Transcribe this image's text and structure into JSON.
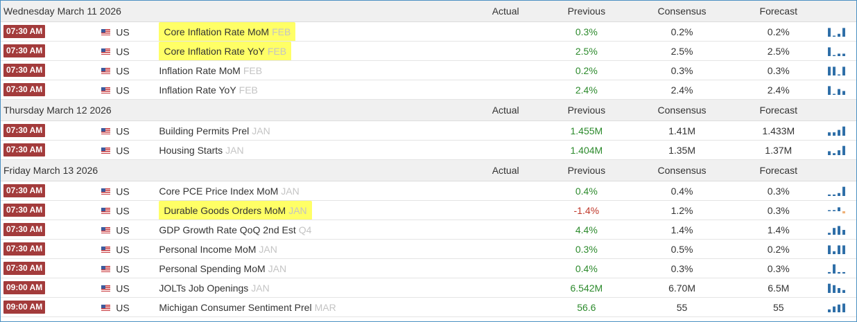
{
  "columns": {
    "actual": "Actual",
    "previous": "Previous",
    "consensus": "Consensus",
    "forecast": "Forecast"
  },
  "colors": {
    "time_badge": "#a33b3b",
    "positive": "#2c8a2c",
    "negative": "#c0392b",
    "highlight": "#ffff66",
    "spark_bar": "#2f6fa8",
    "spark_neg": "#f0b27a"
  },
  "days": [
    {
      "label": "Wednesday March 11 2026",
      "events": [
        {
          "time": "07:30 AM",
          "country": "US",
          "name": "Core Inflation Rate MoM",
          "ref": "FEB",
          "actual": "",
          "previous": "0.3%",
          "prev_trend": "up",
          "consensus": "0.2%",
          "forecast": "0.2%",
          "highlight": true,
          "spark": [
            0.9,
            0,
            0.3,
            0.9
          ]
        },
        {
          "time": "07:30 AM",
          "country": "US",
          "name": "Core Inflation Rate YoY",
          "ref": "FEB",
          "actual": "",
          "previous": "2.5%",
          "prev_trend": "up",
          "consensus": "2.5%",
          "forecast": "2.5%",
          "highlight": true,
          "spark": [
            0.9,
            0,
            0.25,
            0.25
          ]
        },
        {
          "time": "07:30 AM",
          "country": "US",
          "name": "Inflation Rate MoM",
          "ref": "FEB",
          "actual": "",
          "previous": "0.2%",
          "prev_trend": "up",
          "consensus": "0.3%",
          "forecast": "0.3%",
          "highlight": false,
          "spark": [
            0.9,
            0.9,
            0,
            0.9
          ]
        },
        {
          "time": "07:30 AM",
          "country": "US",
          "name": "Inflation Rate YoY",
          "ref": "FEB",
          "actual": "",
          "previous": "2.4%",
          "prev_trend": "up",
          "consensus": "2.4%",
          "forecast": "2.4%",
          "highlight": false,
          "spark": [
            0.9,
            0,
            0.6,
            0.4
          ]
        }
      ]
    },
    {
      "label": "Thursday March 12 2026",
      "events": [
        {
          "time": "07:30 AM",
          "country": "US",
          "name": "Building Permits Prel",
          "ref": "JAN",
          "actual": "",
          "previous": "1.455M",
          "prev_trend": "up",
          "consensus": "1.41M",
          "forecast": "1.433M",
          "highlight": false,
          "spark": [
            0.35,
            0.35,
            0.6,
            0.95
          ]
        },
        {
          "time": "07:30 AM",
          "country": "US",
          "name": "Housing Starts",
          "ref": "JAN",
          "actual": "",
          "previous": "1.404M",
          "prev_trend": "up",
          "consensus": "1.35M",
          "forecast": "1.37M",
          "highlight": false,
          "spark": [
            0.4,
            0.2,
            0.5,
            0.95
          ]
        }
      ]
    },
    {
      "label": "Friday March 13 2026",
      "events": [
        {
          "time": "07:30 AM",
          "country": "US",
          "name": "Core PCE Price Index MoM",
          "ref": "JAN",
          "actual": "",
          "previous": "0.4%",
          "prev_trend": "up",
          "consensus": "0.4%",
          "forecast": "0.3%",
          "highlight": false,
          "spark": [
            0.15,
            0.15,
            0.3,
            0.95
          ]
        },
        {
          "time": "07:30 AM",
          "country": "US",
          "name": "Durable Goods Orders MoM",
          "ref": "JAN",
          "actual": "",
          "previous": "-1.4%",
          "prev_trend": "down",
          "consensus": "1.2%",
          "forecast": "0.3%",
          "highlight": true,
          "spark": [
            0.1,
            0.2,
            0.7,
            -0.4
          ]
        },
        {
          "time": "07:30 AM",
          "country": "US",
          "name": "GDP Growth Rate QoQ 2nd Est",
          "ref": "Q4",
          "actual": "",
          "previous": "4.4%",
          "prev_trend": "up",
          "consensus": "1.4%",
          "forecast": "1.4%",
          "highlight": false,
          "spark": [
            0.2,
            0.7,
            0.9,
            0.5
          ]
        },
        {
          "time": "07:30 AM",
          "country": "US",
          "name": "Personal Income MoM",
          "ref": "JAN",
          "actual": "",
          "previous": "0.3%",
          "prev_trend": "up",
          "consensus": "0.5%",
          "forecast": "0.2%",
          "highlight": false,
          "spark": [
            0.9,
            0.3,
            0.9,
            0.9
          ]
        },
        {
          "time": "07:30 AM",
          "country": "US",
          "name": "Personal Spending MoM",
          "ref": "JAN",
          "actual": "",
          "previous": "0.4%",
          "prev_trend": "up",
          "consensus": "0.3%",
          "forecast": "0.3%",
          "highlight": false,
          "spark": [
            0.15,
            0.95,
            0.15,
            0.15
          ]
        },
        {
          "time": "09:00 AM",
          "country": "US",
          "name": "JOLTs Job Openings",
          "ref": "JAN",
          "actual": "",
          "previous": "6.542M",
          "prev_trend": "up",
          "consensus": "6.70M",
          "forecast": "6.5M",
          "highlight": false,
          "spark": [
            0.95,
            0.8,
            0.5,
            0.3
          ]
        },
        {
          "time": "09:00 AM",
          "country": "US",
          "name": "Michigan Consumer Sentiment Prel",
          "ref": "MAR",
          "actual": "",
          "previous": "56.6",
          "prev_trend": "up",
          "consensus": "55",
          "forecast": "55",
          "highlight": false,
          "spark": [
            0.3,
            0.6,
            0.8,
            0.9
          ]
        }
      ]
    }
  ]
}
